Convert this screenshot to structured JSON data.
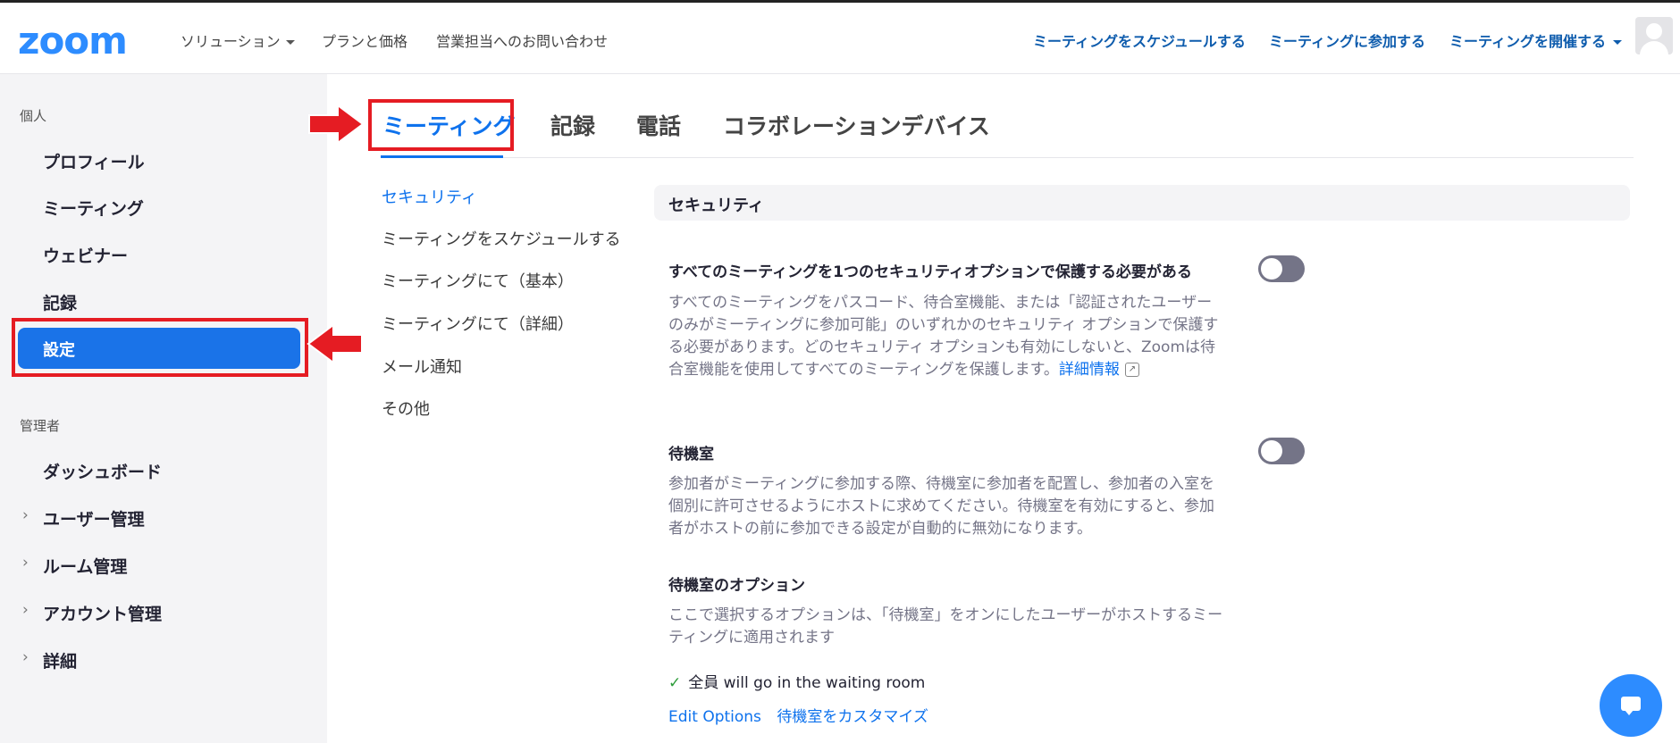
{
  "header": {
    "logo": "zoom",
    "nav": [
      "ソリューション",
      "プランと価格",
      "営業担当へのお問い合わせ"
    ],
    "actions": [
      "ミーティングをスケジュールする",
      "ミーティングに参加する",
      "ミーティングを開催する"
    ]
  },
  "sidebar": {
    "personal_label": "個人",
    "personal_items": [
      "プロフィール",
      "ミーティング",
      "ウェビナー",
      "記録",
      "設定"
    ],
    "admin_label": "管理者",
    "admin_items": [
      "ダッシュボード",
      "ユーザー管理",
      "ルーム管理",
      "アカウント管理",
      "詳細"
    ],
    "chevron": "›"
  },
  "tabs": [
    "ミーティング",
    "記録",
    "電話",
    "コラボレーションデバイス"
  ],
  "submenu": [
    "セキュリティ",
    "ミーティングをスケジュールする",
    "ミーティングにて（基本）",
    "ミーティングにて（詳細）",
    "メール通知",
    "その他"
  ],
  "content": {
    "section_title": "セキュリティ",
    "setting1_title": "すべてのミーティングを1つのセキュリティオプションで保護する必要がある",
    "setting1_desc_1": "すべてのミーティングをパスコード、待合室機能、または「認証されたユーザー",
    "setting1_desc_2": "のみがミーティングに参加可能」のいずれかのセキュリティ オプションで保護す",
    "setting1_desc_3": "る必要があります。どのセキュリティ オプションも有効にしないと、Zoomは待",
    "setting1_desc_4": "合室機能を使用してすべてのミーティングを保護します。",
    "setting1_link": "詳細情報",
    "setting2_title": "待機室",
    "setting2_desc_1": "参加者がミーティングに参加する際、待機室に参加者を配置し、参加者の入室を",
    "setting2_desc_2": "個別に許可させるようにホストに求めてください。待機室を有効にすると、参加",
    "setting2_desc_3": "者がホストの前に参加できる設定が自動的に無効になります。",
    "setting3_title": "待機室のオプション",
    "setting3_desc_1": "ここで選択するオプションは、「待機室」をオンにしたユーザーがホストするミー",
    "setting3_desc_2": "ティングに適用されます",
    "option_check": "✓",
    "option_text": "全員 will go in the waiting room",
    "edit_options": "Edit Options",
    "customize": "待機室をカスタマイズ",
    "toggle1_on": false,
    "toggle2_on": false
  },
  "icons": {
    "external_link": "external-link-icon",
    "chat": "chat-icon",
    "avatar": "avatar-icon"
  },
  "colors": {
    "accent": "#0e72ed",
    "active_item_bg": "#1a73e8",
    "highlight_red": "#e51c23",
    "toggle_off": "#747487"
  }
}
